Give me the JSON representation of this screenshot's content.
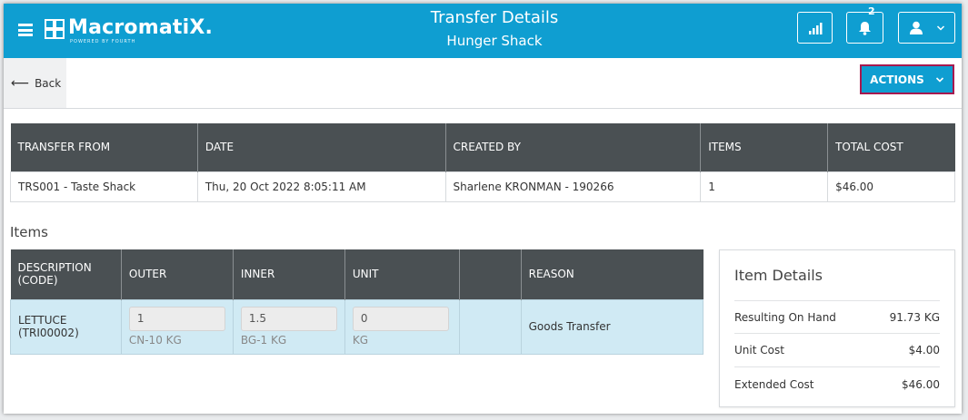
{
  "app": {
    "logo_text": "MacromatiX.",
    "logo_sub": "POWERED BY FOURTH",
    "title": "Transfer Details",
    "subtitle": "Hunger Shack",
    "notification_count": "2",
    "brand_color": "#0f9ed1"
  },
  "toolbar": {
    "back_label": "Back",
    "actions_label": "ACTIONS"
  },
  "summary": {
    "headers": [
      "TRANSFER FROM",
      "DATE",
      "CREATED BY",
      "ITEMS",
      "TOTAL COST"
    ],
    "row": [
      "TRS001 - Taste Shack",
      "Thu, 20 Oct 2022 8:05:11 AM",
      "Sharlene KRONMAN - 190266",
      "1",
      "$46.00"
    ]
  },
  "items_section": {
    "title": "Items",
    "headers": {
      "description_line1": "DESCRIPTION",
      "description_line2": "(CODE)",
      "outer": "OUTER",
      "inner": "INNER",
      "unit": "UNIT",
      "blank": "",
      "reason": "REASON"
    },
    "row": {
      "description": "LETTUCE",
      "code": "(TRI00002)",
      "outer_value": "1",
      "outer_unit": "CN-10 KG",
      "inner_value": "1.5",
      "inner_unit": "BG-1 KG",
      "unit_value": "0",
      "unit_unit": "KG",
      "reason": "Goods Transfer"
    }
  },
  "item_details": {
    "title": "Item Details",
    "rows": [
      {
        "label": "Resulting On Hand",
        "value": "91.73 KG"
      },
      {
        "label": "Unit Cost",
        "value": "$4.00"
      },
      {
        "label": "Extended Cost",
        "value": "$46.00"
      }
    ]
  }
}
